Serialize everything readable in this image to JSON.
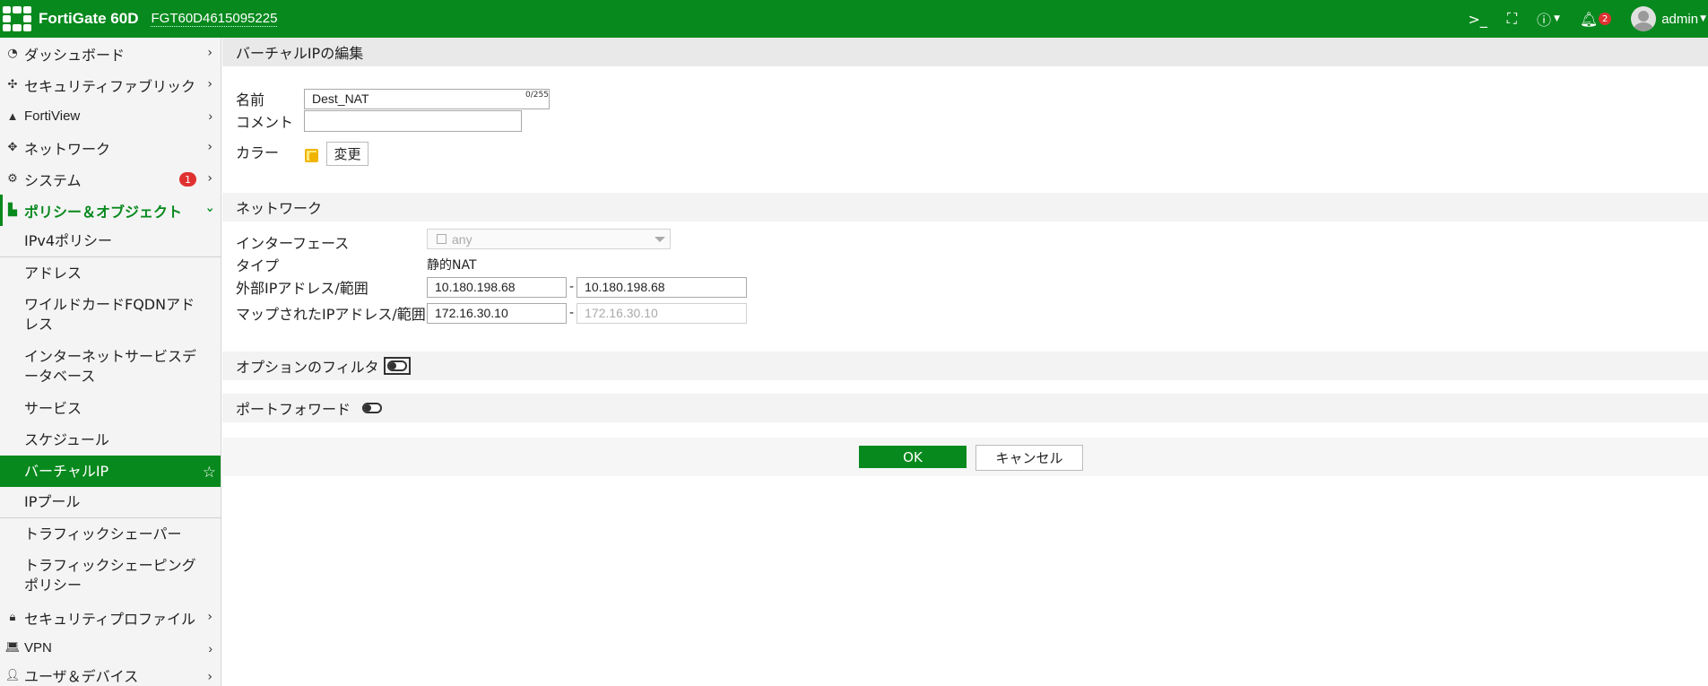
{
  "topbar": {
    "product": "FortiGate 60D",
    "serial": "FGT60D4615095225",
    "notification_count": "2",
    "user": "admin",
    "accent": "#07891d"
  },
  "sidebar": {
    "items": [
      {
        "label": "ダッシュボード",
        "icon": "dashboard-icon"
      },
      {
        "label": "セキュリティファブリック",
        "icon": "fabric-icon"
      },
      {
        "label": "FortiView",
        "icon": "chart-icon"
      },
      {
        "label": "ネットワーク",
        "icon": "network-icon"
      },
      {
        "label": "システム",
        "icon": "gear-icon",
        "badge": "1"
      },
      {
        "label": "ポリシー＆オブジェクト",
        "icon": "policy-icon"
      }
    ],
    "subitems": [
      "IPv4ポリシー",
      "アドレス",
      "ワイルドカードFQDNアドレス",
      "インターネットサービスデータベース",
      "サービス",
      "スケジュール",
      "バーチャルIP",
      "IPプール",
      "トラフィックシェーパー",
      "トラフィックシェーピングポリシー"
    ],
    "bottom_items": [
      {
        "label": "セキュリティプロファイル",
        "icon": "lock-icon"
      },
      {
        "label": "VPN",
        "icon": "laptop-icon"
      },
      {
        "label": "ユーザ＆デバイス",
        "icon": "user-icon"
      }
    ]
  },
  "main": {
    "header": "バーチャルIPの編集",
    "name_label": "名前",
    "name_value": "Dest_NAT",
    "comment_label": "コメント",
    "comment_counter": "0/255",
    "color_label": "カラー",
    "color_change": "変更",
    "network_section": "ネットワーク",
    "interface_label": "インターフェース",
    "interface_value": "any",
    "type_label": "タイプ",
    "type_value": "静的NAT",
    "ext_ip_label": "外部IPアドレス/範囲",
    "ext_ip_start": "10.180.198.68",
    "ext_ip_end": "10.180.198.68",
    "mapped_ip_label": "マップされたIPアドレス/範囲",
    "mapped_ip_start": "172.16.30.10",
    "mapped_ip_end": "172.16.30.10",
    "range_dash": "-",
    "filter_label": "オプションのフィルタ",
    "port_forward_label": "ポートフォワード",
    "ok": "OK",
    "cancel": "キャンセル"
  }
}
